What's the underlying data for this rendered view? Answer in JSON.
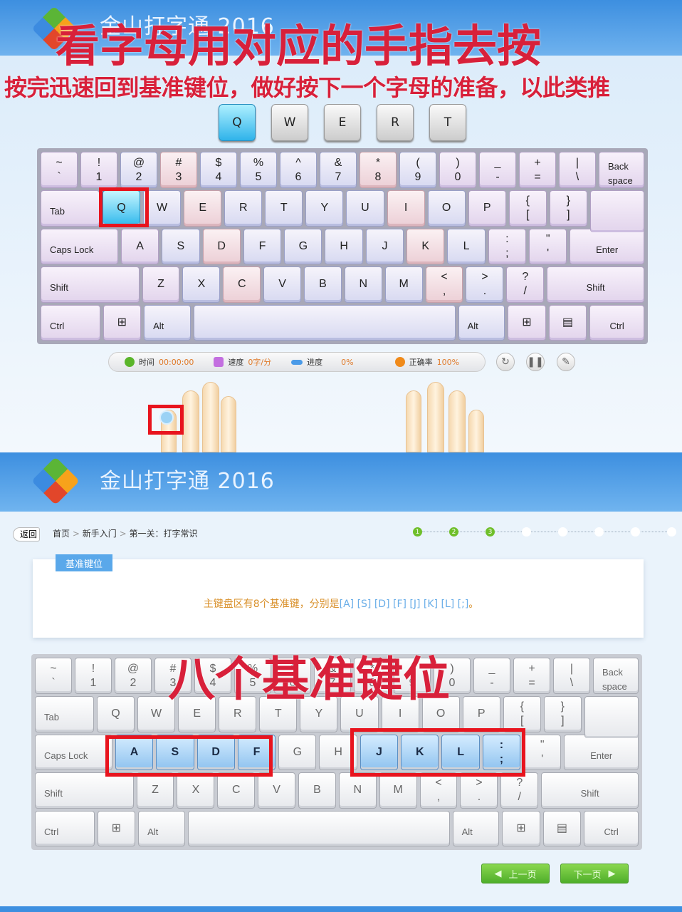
{
  "top": {
    "app_title": "金山打字通 2016",
    "overlay_title": "看字母用对应的手指去按",
    "overlay_sub": "按完迅速回到基准键位，做好按下一个字母的准备，以此类推",
    "preview_keys": [
      "Q",
      "W",
      "E",
      "R",
      "T"
    ],
    "current_key": "Q",
    "status": {
      "time_label": "时间",
      "time": "00:00:00",
      "speed_label": "速度",
      "speed": "0字/分",
      "progress_label": "进度",
      "progress": "0%",
      "accuracy_label": "正确率",
      "accuracy": "100%"
    },
    "controls": [
      "restart-icon",
      "pause-icon",
      "settings-icon"
    ]
  },
  "bottom": {
    "app_title": "金山打字通 2016",
    "back": "返回",
    "breadcrumb": [
      "首页",
      "新手入门",
      "第一关：打字常识"
    ],
    "sep": ">",
    "steps": [
      {
        "n": "1",
        "done": true
      },
      {
        "n": "2",
        "done": true
      },
      {
        "n": "3",
        "done": true
      },
      {
        "n": "",
        "done": false
      },
      {
        "n": "",
        "done": false
      },
      {
        "n": "",
        "done": false
      },
      {
        "n": "",
        "done": false
      },
      {
        "n": "",
        "done": false
      }
    ],
    "tag": "基准键位",
    "desc_main": "主键盘区有8个基准键，分别是",
    "desc_keys": "[A] [S] [D] [F] [J] [K] [L] [;]",
    "desc_end": "。",
    "overlay": "八个基准键位",
    "prev_page": "上一页",
    "next_page": "下一页",
    "home_keys": [
      "A",
      "S",
      "D",
      "F",
      "J",
      "K",
      "L",
      ";"
    ]
  },
  "colors": {
    "overlay": "#d8203a",
    "accent": "#5aa8ea",
    "green": "#4fae2a",
    "value": "#e07a2a",
    "desc": "#d9902a",
    "desc_keys": "#6aaee8"
  },
  "keyboard": [
    [
      {
        "t": "~",
        "b": "`",
        "tone": "v"
      },
      {
        "t": "!",
        "b": "1",
        "tone": "v"
      },
      {
        "t": "@",
        "b": "2",
        "tone": "b"
      },
      {
        "t": "#",
        "b": "3",
        "tone": "p"
      },
      {
        "t": "$",
        "b": "4",
        "tone": "b"
      },
      {
        "t": "%",
        "b": "5",
        "tone": "b"
      },
      {
        "t": "^",
        "b": "6",
        "tone": "b"
      },
      {
        "t": "&",
        "b": "7",
        "tone": "b"
      },
      {
        "t": "*",
        "b": "8",
        "tone": "p"
      },
      {
        "t": "(",
        "b": "9",
        "tone": "b"
      },
      {
        "t": ")",
        "b": "0",
        "tone": "v"
      },
      {
        "t": "_",
        "b": "-",
        "tone": "v"
      },
      {
        "t": "+",
        "b": "=",
        "tone": "v"
      },
      {
        "t": "|",
        "b": "\\",
        "tone": "v"
      },
      {
        "t": "Back",
        "b": "space",
        "tone": "v",
        "mod": true
      }
    ],
    [
      {
        "t": "Tab",
        "tone": "v",
        "mod": true,
        "w": 1.35
      },
      {
        "t": "Q",
        "tone": "v"
      },
      {
        "t": "W",
        "tone": "b"
      },
      {
        "t": "E",
        "tone": "p"
      },
      {
        "t": "R",
        "tone": "b"
      },
      {
        "t": "T",
        "tone": "b"
      },
      {
        "t": "Y",
        "tone": "b"
      },
      {
        "t": "U",
        "tone": "b"
      },
      {
        "t": "I",
        "tone": "p"
      },
      {
        "t": "O",
        "tone": "b"
      },
      {
        "t": "P",
        "tone": "v"
      },
      {
        "t": "{",
        "b": "[",
        "tone": "v"
      },
      {
        "t": "}",
        "b": "]",
        "tone": "v"
      },
      {
        "t": "",
        "tone": "v",
        "w": 1.45,
        "enter": true
      }
    ],
    [
      {
        "t": "Caps Lock",
        "tone": "v",
        "mod": true,
        "w": 1.85
      },
      {
        "t": "A",
        "tone": "v"
      },
      {
        "t": "S",
        "tone": "b"
      },
      {
        "t": "D",
        "tone": "p"
      },
      {
        "t": "F",
        "tone": "b"
      },
      {
        "t": "G",
        "tone": "b"
      },
      {
        "t": "H",
        "tone": "b"
      },
      {
        "t": "J",
        "tone": "b"
      },
      {
        "t": "K",
        "tone": "p"
      },
      {
        "t": "L",
        "tone": "b"
      },
      {
        "t": ":",
        "b": ";",
        "tone": "v"
      },
      {
        "t": "\"",
        "b": "'",
        "tone": "v"
      },
      {
        "t": "Enter",
        "tone": "v",
        "mod": true,
        "c": true,
        "w": 2
      }
    ],
    [
      {
        "t": "Shift",
        "tone": "v",
        "mod": true,
        "w": 2.45
      },
      {
        "t": "Z",
        "tone": "v"
      },
      {
        "t": "X",
        "tone": "b"
      },
      {
        "t": "C",
        "tone": "p"
      },
      {
        "t": "V",
        "tone": "b"
      },
      {
        "t": "B",
        "tone": "b"
      },
      {
        "t": "N",
        "tone": "b"
      },
      {
        "t": "M",
        "tone": "b"
      },
      {
        "t": "<",
        "b": ",",
        "tone": "p"
      },
      {
        "t": ">",
        "b": ".",
        "tone": "b"
      },
      {
        "t": "?",
        "b": "/",
        "tone": "v"
      },
      {
        "t": "Shift",
        "tone": "v",
        "mod": true,
        "c": true,
        "w": 2.65
      }
    ],
    [
      {
        "t": "Ctrl",
        "tone": "v",
        "mod": true,
        "w": 1.35
      },
      {
        "t": "⊞",
        "tone": "v",
        "icon": "windows-icon"
      },
      {
        "t": "Alt",
        "tone": "b",
        "mod": true
      },
      {
        "t": "",
        "tone": "b",
        "w": 7.1,
        "space": true
      },
      {
        "t": "Alt",
        "tone": "b",
        "mod": true
      },
      {
        "t": "⊞",
        "tone": "v",
        "icon": "windows-icon"
      },
      {
        "t": "▤",
        "tone": "v",
        "icon": "menu-icon"
      },
      {
        "t": "Ctrl",
        "tone": "v",
        "mod": true,
        "c": true,
        "w": 1.45
      }
    ]
  ]
}
